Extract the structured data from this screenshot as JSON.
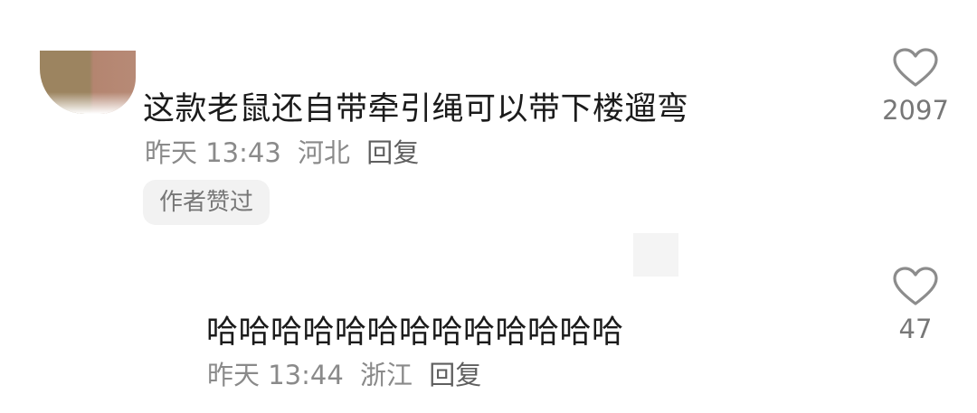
{
  "comments": [
    {
      "text": "这款老鼠还自带牵引绳可以带下楼遛弯",
      "time": "昨天 13:43",
      "location": "河北",
      "reply_label": "回复",
      "badge": "作者赞过",
      "likes": "2097",
      "icon": "heart-outline-icon"
    },
    {
      "text": "哈哈哈哈哈哈哈哈哈哈哈哈哈",
      "time": "昨天 13:44",
      "location": "浙江",
      "reply_label": "回复",
      "likes": "47",
      "icon": "heart-outline-icon"
    }
  ],
  "colors": {
    "text": "#1b1b1b",
    "meta": "#8a8a8a",
    "badge_bg": "#f2f2f2",
    "icon": "#8c8c8c"
  }
}
